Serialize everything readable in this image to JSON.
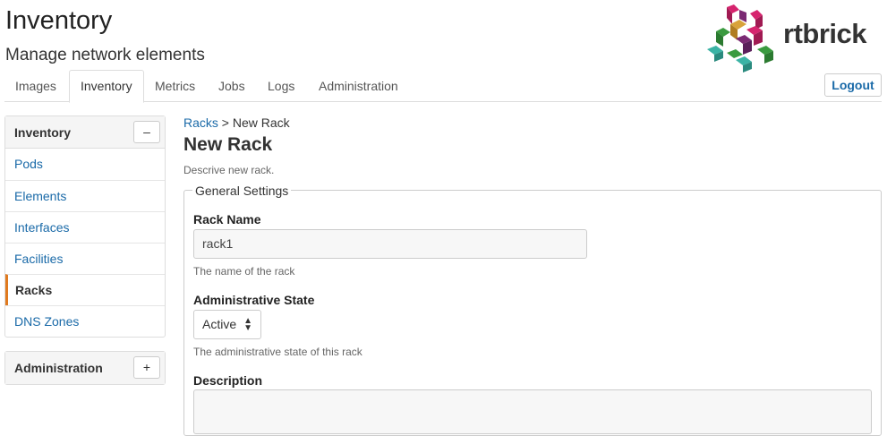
{
  "header": {
    "title": "Inventory",
    "subtitle": "Manage network elements",
    "logo_text": "rtbrick",
    "logout_label": "Logout"
  },
  "nav": {
    "tabs": [
      {
        "label": "Images"
      },
      {
        "label": "Inventory",
        "active": true
      },
      {
        "label": "Metrics"
      },
      {
        "label": "Jobs"
      },
      {
        "label": "Logs"
      },
      {
        "label": "Administration"
      }
    ]
  },
  "sidebar": {
    "inventory_panel": {
      "title": "Inventory",
      "toggle": "–",
      "items": [
        {
          "label": "Pods"
        },
        {
          "label": "Elements"
        },
        {
          "label": "Interfaces"
        },
        {
          "label": "Facilities"
        },
        {
          "label": "Racks",
          "active": true
        },
        {
          "label": "DNS Zones"
        }
      ]
    },
    "admin_panel": {
      "title": "Administration",
      "toggle": "+"
    }
  },
  "main": {
    "breadcrumb": {
      "parent": "Racks",
      "separator": ">",
      "current": "New Rack"
    },
    "title": "New Rack",
    "description": "Descrive new rack.",
    "fieldset": {
      "legend": "General Settings",
      "rack_name": {
        "label": "Rack Name",
        "value": "rack1",
        "help": "The name of the rack"
      },
      "admin_state": {
        "label": "Administrative State",
        "value": "Active",
        "help": "The administrative state of this rack"
      },
      "description": {
        "label": "Description",
        "value": ""
      }
    }
  },
  "colors": {
    "link": "#1a6aa8",
    "active_accent": "#e07a1f",
    "logo_magenta": "#d6246e",
    "logo_teal": "#3bb3a5",
    "logo_green": "#3a9a3f",
    "logo_gold": "#d8a23a"
  }
}
